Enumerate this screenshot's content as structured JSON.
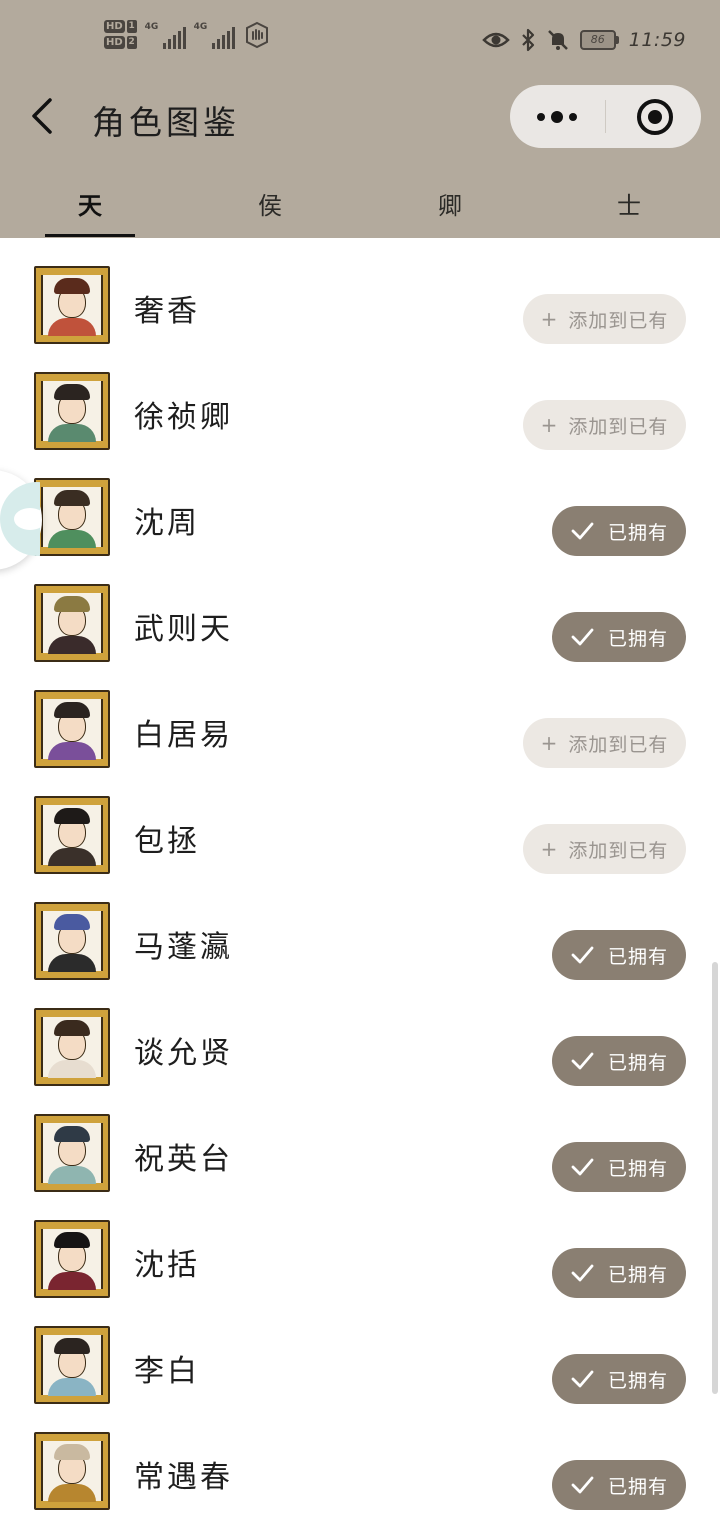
{
  "status_bar": {
    "hd1": "HD",
    "hd1_num": "1",
    "hd2": "HD",
    "hd2_num": "2",
    "net1": "4G",
    "net2": "4G",
    "battery": "86",
    "time": "11:59",
    "icons": [
      "eye-icon",
      "bluetooth-icon",
      "bell-off-icon"
    ]
  },
  "header": {
    "title": "角色图鉴",
    "back_icon": "chevron-left-icon",
    "more_icon": "more-dots-icon",
    "close_icon": "target-icon"
  },
  "tabs": [
    {
      "label": "天",
      "active": true
    },
    {
      "label": "侯",
      "active": false
    },
    {
      "label": "卿",
      "active": false
    },
    {
      "label": "士",
      "active": false
    }
  ],
  "labels": {
    "add": "添加到已有",
    "owned": "已拥有",
    "add_icon": "+"
  },
  "characters": [
    {
      "name": "奢香",
      "owned": false,
      "hair": "#5a2b1c",
      "robe": "#c0523b"
    },
    {
      "name": "徐祯卿",
      "owned": false,
      "hair": "#2b2420",
      "robe": "#5a8a6f"
    },
    {
      "name": "沈周",
      "owned": true,
      "hair": "#3a2d22",
      "robe": "#4f8f5e"
    },
    {
      "name": "武则天",
      "owned": true,
      "hair": "#8b7a42",
      "robe": "#3a2b2b"
    },
    {
      "name": "白居易",
      "owned": false,
      "hair": "#2b2420",
      "robe": "#7a4f9a"
    },
    {
      "name": "包拯",
      "owned": false,
      "hair": "#1e1a18",
      "robe": "#3a302a"
    },
    {
      "name": "马蓬瀛",
      "owned": true,
      "hair": "#4a5aa0",
      "robe": "#2b2b2b"
    },
    {
      "name": "谈允贤",
      "owned": true,
      "hair": "#3a2a1e",
      "robe": "#e7ddd0"
    },
    {
      "name": "祝英台",
      "owned": true,
      "hair": "#2f3a46",
      "robe": "#8fb5b0"
    },
    {
      "name": "沈括",
      "owned": true,
      "hair": "#161414",
      "robe": "#7a2530"
    },
    {
      "name": "李白",
      "owned": true,
      "hair": "#2b2420",
      "robe": "#8ab4c4"
    },
    {
      "name": "常遇春",
      "owned": true,
      "hair": "#c9b9a0",
      "robe": "#b7862f"
    }
  ],
  "colors": {
    "header_bg": "#b3aa9d",
    "owned_bg": "#8a7f72",
    "add_bg": "#ece8e3"
  }
}
